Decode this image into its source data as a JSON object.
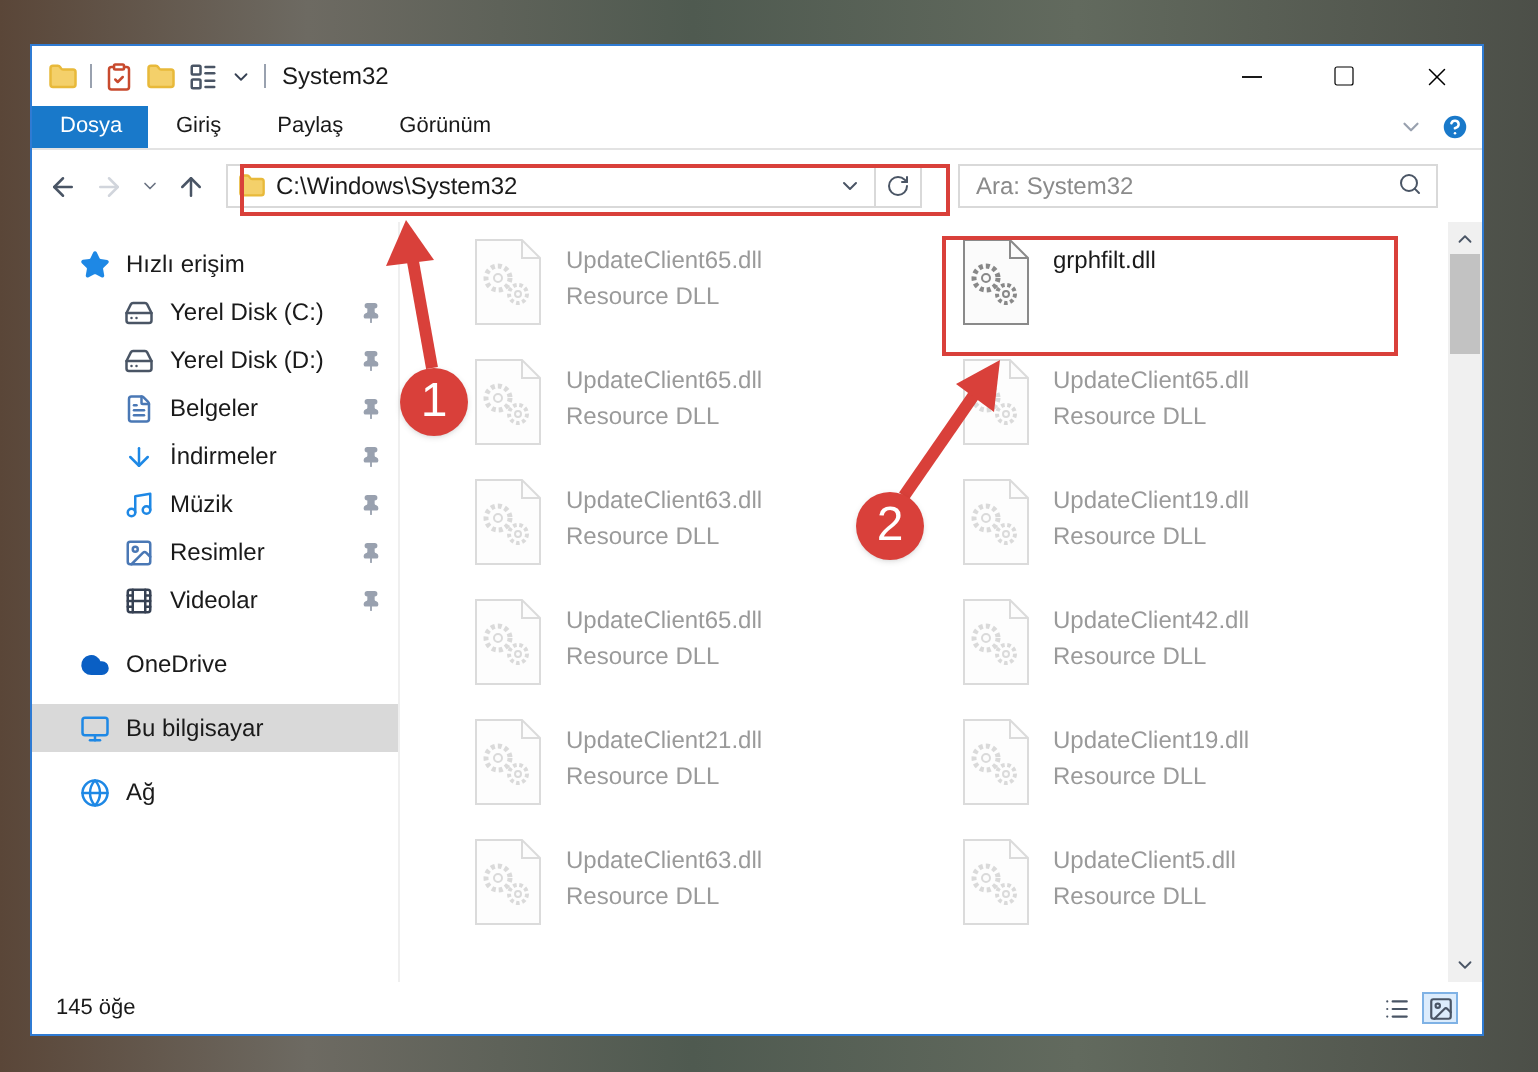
{
  "window": {
    "title": "System32"
  },
  "ribbon_tabs": [
    {
      "label": "Dosya",
      "selected": true
    },
    {
      "label": "Giriş",
      "selected": false
    },
    {
      "label": "Paylaş",
      "selected": false
    },
    {
      "label": "Görünüm",
      "selected": false
    }
  ],
  "address_bar": {
    "path": "C:\\Windows\\System32"
  },
  "search": {
    "placeholder": "Ara: System32"
  },
  "sidebar": {
    "items": [
      {
        "label": "Hızlı erişim",
        "kind": "star",
        "selected": false,
        "children": [
          {
            "label": "Yerel Disk (C:)",
            "kind": "drive",
            "pinned": true,
            "selected": false
          },
          {
            "label": "Yerel Disk (D:)",
            "kind": "drive",
            "pinned": true,
            "selected": false
          },
          {
            "label": "Belgeler",
            "kind": "document",
            "pinned": true,
            "selected": false
          },
          {
            "label": "İndirmeler",
            "kind": "download",
            "pinned": true,
            "selected": false
          },
          {
            "label": "Müzik",
            "kind": "music",
            "pinned": true,
            "selected": false
          },
          {
            "label": "Resimler",
            "kind": "picture",
            "pinned": true,
            "selected": false
          },
          {
            "label": "Videolar",
            "kind": "video",
            "pinned": true,
            "selected": false
          }
        ]
      },
      {
        "label": "OneDrive",
        "kind": "cloud",
        "selected": false
      },
      {
        "label": "Bu bilgisayar",
        "kind": "computer",
        "selected": true
      },
      {
        "label": "Ağ",
        "kind": "network",
        "selected": false
      }
    ]
  },
  "files": [
    {
      "name": "UpdateClient65.dll",
      "type": "Resource DLL",
      "faded": true
    },
    {
      "name": "grphfilt.dll",
      "faded": false
    },
    {
      "name": "UpdateClient65.dll",
      "type": "Resource DLL",
      "faded": true
    },
    {
      "name": "UpdateClient65.dll",
      "type": "Resource DLL",
      "faded": true
    },
    {
      "name": "UpdateClient63.dll",
      "type": "Resource DLL",
      "faded": true
    },
    {
      "name": "UpdateClient19.dll",
      "type": "Resource DLL",
      "faded": true
    },
    {
      "name": "UpdateClient65.dll",
      "type": "Resource DLL",
      "faded": true
    },
    {
      "name": "UpdateClient42.dll",
      "type": "Resource DLL",
      "faded": true
    },
    {
      "name": "UpdateClient21.dll",
      "type": "Resource DLL",
      "faded": true
    },
    {
      "name": "UpdateClient19.dll",
      "type": "Resource DLL",
      "faded": true
    },
    {
      "name": "UpdateClient63.dll",
      "type": "Resource DLL",
      "faded": true
    },
    {
      "name": "UpdateClient5.dll",
      "type": "Resource DLL",
      "faded": true
    }
  ],
  "status_bar": {
    "count": "145 öğe",
    "views": [
      {
        "kind": "details",
        "selected": false
      },
      {
        "kind": "large-icons",
        "selected": true
      }
    ]
  },
  "annotations": [
    {
      "number": "1"
    },
    {
      "number": "2"
    }
  ]
}
